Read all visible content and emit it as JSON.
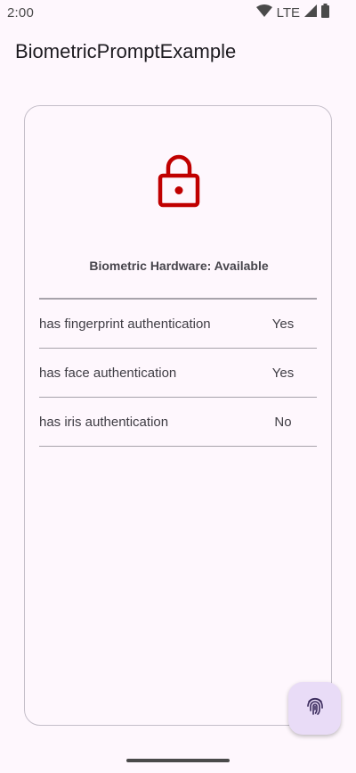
{
  "status_bar": {
    "time": "2:00",
    "network": "LTE",
    "icons": [
      "wifi-icon",
      "cell-signal-icon",
      "battery-icon"
    ]
  },
  "app_bar": {
    "title": "BiometricPromptExample"
  },
  "card": {
    "icon": "lock-icon",
    "lock_color": "#c00000",
    "hardware_status": "Biometric Hardware: Available",
    "capabilities": [
      {
        "label": "has fingerprint authentication",
        "value": "Yes"
      },
      {
        "label": "has face authentication",
        "value": "Yes"
      },
      {
        "label": "has iris authentication",
        "value": "No"
      }
    ]
  },
  "fab": {
    "icon": "fingerprint-icon",
    "color": "#e9dcf7"
  }
}
